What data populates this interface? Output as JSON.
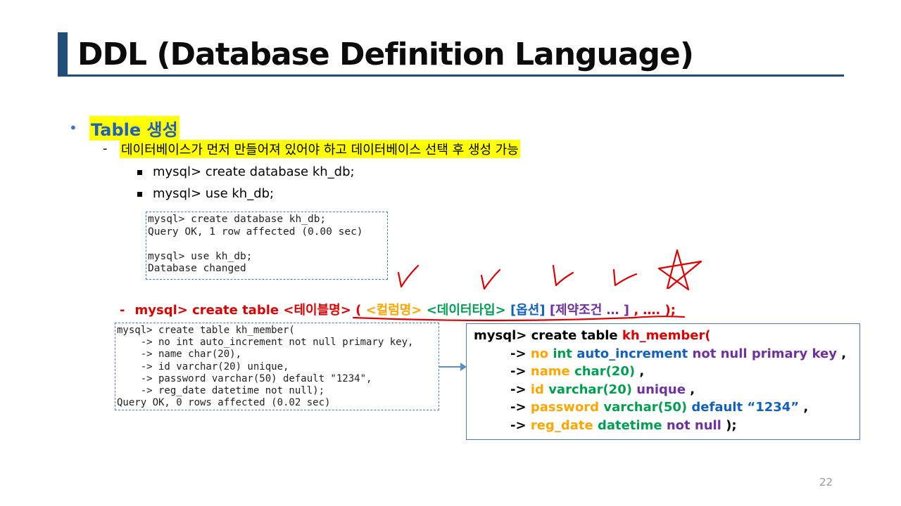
{
  "title": "DDL (Database Definition Language)",
  "section": {
    "heading": "Table 생성",
    "note": "데이터베이스가 먼저 만들어져 있어야 하고 데이터베이스 선택 후 생성 가능",
    "commands": [
      "mysql>  create database kh_db;",
      "mysql>  use kh_db;"
    ]
  },
  "console1": [
    "mysql> create database kh_db;",
    "Query OK, 1 row affected (0.00 sec)",
    "",
    "mysql> use kh_db;",
    "Database changed"
  ],
  "syntax": {
    "dash": "-",
    "prefix": "mysql>  create table",
    "table_name": "<테이블명>",
    "open": "(",
    "column_name": "<컬럼명>",
    "data_type": "<데이터타입>",
    "option": "[옵션]",
    "constraint": "[제약조건 … ]",
    "rest": ", …. );"
  },
  "console2": [
    "mysql> create table kh_member(",
    "    -> no int auto_increment not null primary key,",
    "    -> name char(20),",
    "    -> id varchar(20) unique,",
    "    -> password varchar(50) default \"1234\",",
    "    -> reg_date datetime not null);",
    "Query OK, 0 rows affected (0.02 sec)"
  ],
  "code_box": {
    "l1_prefix": "mysql>  create table",
    "l1_table": "kh_member(",
    "arrow": "->",
    "r1": {
      "col": "no",
      "type": "int",
      "opt": "auto_increment",
      "cons": "not null primary  key",
      "end": ","
    },
    "r2": {
      "col": "name",
      "type": "char(20)",
      "end": ","
    },
    "r3": {
      "col": "id",
      "type": "varchar(20)",
      "cons": "unique",
      "end": ","
    },
    "r4": {
      "col": "password",
      "type": "varchar(50)",
      "opt": "default",
      "val": "“1234”",
      "end": ","
    },
    "r5": {
      "col": "reg_date",
      "type": "datetime",
      "cons": "not null",
      "end": ");"
    }
  },
  "page_number": "22",
  "colors": {
    "title_bar": "#1f4e79",
    "highlight": "#ffff00",
    "table_name": "#e00000",
    "column": "#ffa500",
    "data_type": "#00a050",
    "option": "#1060c0",
    "constraint": "#7030a0",
    "ink": "#e00000"
  }
}
